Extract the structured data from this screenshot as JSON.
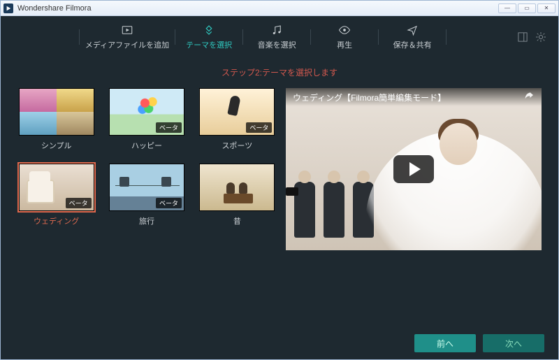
{
  "window": {
    "title": "Wondershare Filmora"
  },
  "steps": {
    "items": [
      {
        "label": "メディアファイルを追加"
      },
      {
        "label": "テーマを選択"
      },
      {
        "label": "音楽を選択"
      },
      {
        "label": "再生"
      },
      {
        "label": "保存＆共有"
      }
    ],
    "active_index": 1
  },
  "caption": "ステップ2:テーマを選択します",
  "themes": {
    "selected_index": 3,
    "items": [
      {
        "label": "シンプル",
        "badge": null
      },
      {
        "label": "ハッピー",
        "badge": "ベータ"
      },
      {
        "label": "スポーツ",
        "badge": "ベータ"
      },
      {
        "label": "ウェディング",
        "badge": "ベータ"
      },
      {
        "label": "旅行",
        "badge": "ベータ"
      },
      {
        "label": "昔",
        "badge": null
      }
    ]
  },
  "preview": {
    "video_title": "ウェディング【Filmora簡単編集モード】"
  },
  "footer": {
    "prev": "前へ",
    "next": "次へ"
  }
}
